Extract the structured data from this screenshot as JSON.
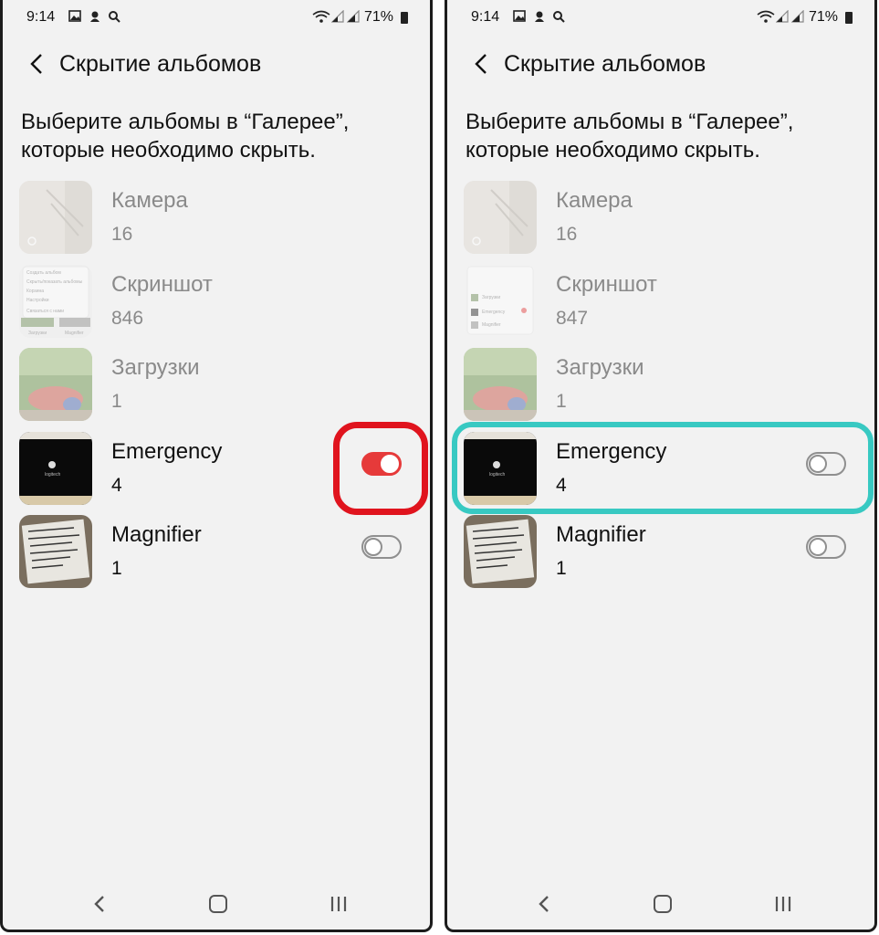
{
  "status": {
    "time": "9:14",
    "battery": "71%"
  },
  "appbar": {
    "title": "Скрытие альбомов"
  },
  "description": "Выберите альбомы в “Галерее”, которые необходимо скрыть.",
  "screens": [
    {
      "albums": [
        {
          "name": "Камера",
          "count": "16",
          "hidden_toggle": false,
          "dim": true
        },
        {
          "name": "Скриншот",
          "count": "846",
          "hidden_toggle": false,
          "dim": true
        },
        {
          "name": "Загрузки",
          "count": "1",
          "hidden_toggle": false,
          "dim": true
        },
        {
          "name": "Emergency",
          "count": "4",
          "hidden_toggle": true,
          "toggle_on": true
        },
        {
          "name": "Magnifier",
          "count": "1",
          "hidden_toggle": true,
          "toggle_on": false
        }
      ],
      "highlight_color": "#e0141e"
    },
    {
      "albums": [
        {
          "name": "Камера",
          "count": "16",
          "hidden_toggle": false,
          "dim": true
        },
        {
          "name": "Скриншот",
          "count": "847",
          "hidden_toggle": false,
          "dim": true
        },
        {
          "name": "Загрузки",
          "count": "1",
          "hidden_toggle": false,
          "dim": true
        },
        {
          "name": "Emergency",
          "count": "4",
          "hidden_toggle": true,
          "toggle_on": false
        },
        {
          "name": "Magnifier",
          "count": "1",
          "hidden_toggle": true,
          "toggle_on": false
        }
      ],
      "highlight_color": "#38c9c2"
    }
  ],
  "screenshot_menu_items": [
    "Создать альбом",
    "Скрыть/показать альбомы",
    "Корзина",
    "Настройки",
    "Связаться с нами"
  ],
  "screenshot_thumb_labels": [
    "Загрузки",
    "Magnifier"
  ],
  "screenshot_thumb_labels_2": [
    "Загрузки",
    "Emergency",
    "Magnifier"
  ],
  "accent": {
    "toggle_on": "#e63a3a"
  }
}
